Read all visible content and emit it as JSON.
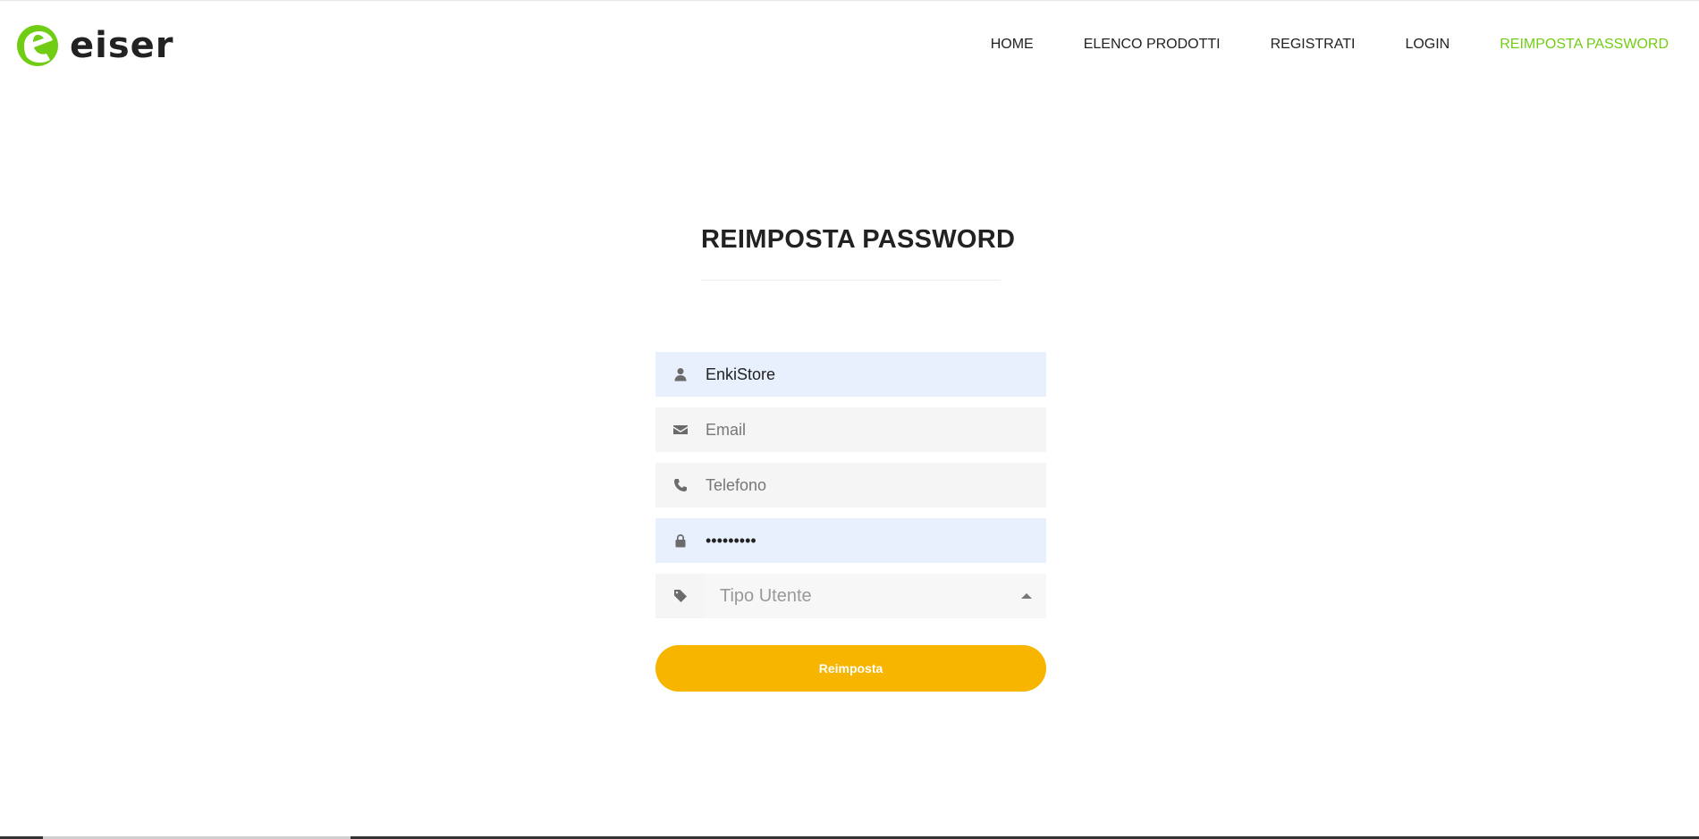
{
  "brand": {
    "name": "eiser",
    "accent": "#71cd14"
  },
  "nav": {
    "items": [
      {
        "label": "HOME"
      },
      {
        "label": "ELENCO PRODOTTI"
      },
      {
        "label": "REGISTRATI"
      },
      {
        "label": "LOGIN"
      },
      {
        "label": "REIMPOSTA PASSWORD",
        "active": true
      }
    ]
  },
  "page": {
    "title": "REIMPOSTA PASSWORD"
  },
  "form": {
    "username": {
      "value": "EnkiStore",
      "icon": "user-icon"
    },
    "email": {
      "placeholder": "Email",
      "icon": "envelope-icon"
    },
    "phone": {
      "placeholder": "Telefono",
      "icon": "phone-icon"
    },
    "password": {
      "value": "•••••••••",
      "icon": "lock-icon"
    },
    "user_type": {
      "selected": "Tipo Utente",
      "icon": "tag-icon"
    },
    "submit_label": "Reimposta",
    "submit_color": "#f7b500"
  }
}
